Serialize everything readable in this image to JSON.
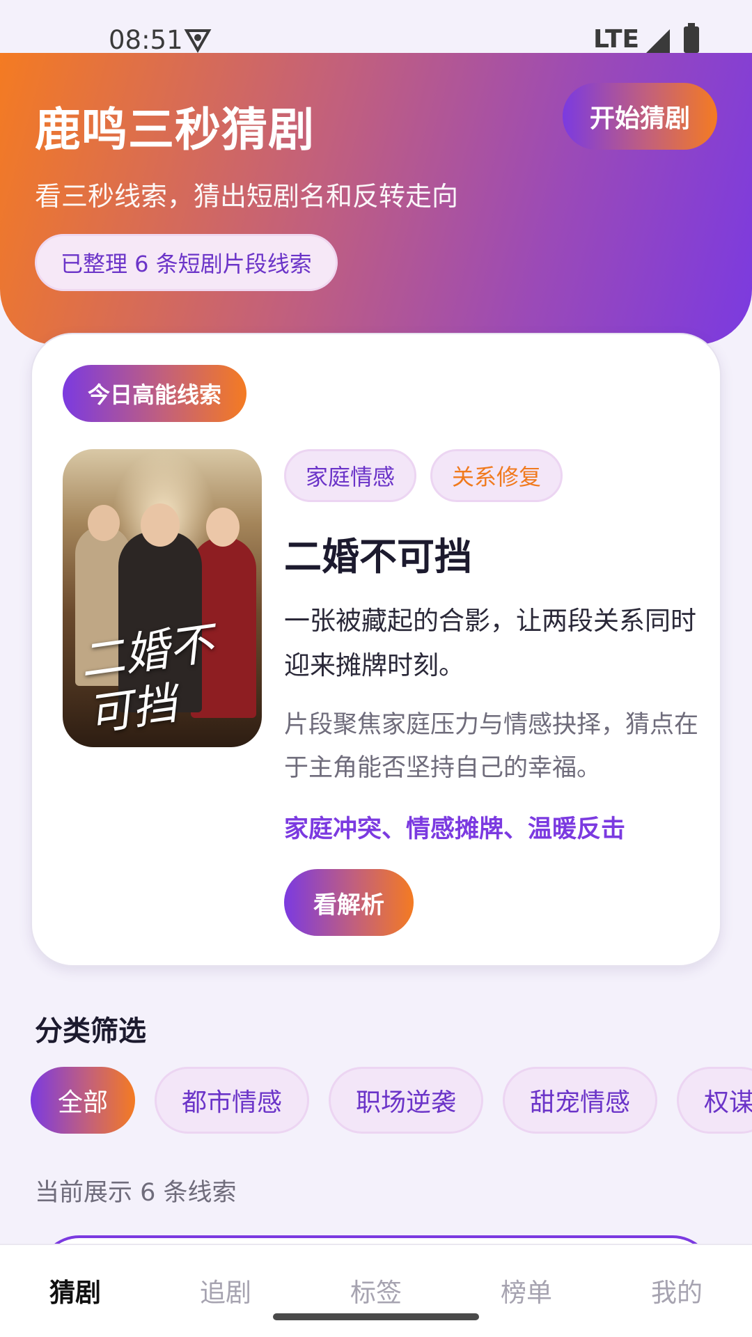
{
  "status_bar": {
    "time": "08:51",
    "network": "LTE"
  },
  "hero": {
    "title": "鹿鸣三秒猜剧",
    "subtitle": "看三秒线索，猜出短剧名和反转走向",
    "count_pill": "已整理 6 条短剧片段线索",
    "start_button": "开始猜剧"
  },
  "feature": {
    "badge": "今日高能线索",
    "poster_title": "二婚不可挡",
    "tags": [
      "家庭情感",
      "关系修复"
    ],
    "title": "二婚不可挡",
    "description": "一张被藏起的合影，让两段关系同时迎来摊牌时刻。",
    "detail": "片段聚焦家庭压力与情感抉择，猜点在于主角能否坚持自己的幸福。",
    "keywords": "家庭冲突、情感摊牌、温暖反击",
    "analysis_button": "看解析"
  },
  "categories": {
    "title": "分类筛选",
    "chips": [
      "全部",
      "都市情感",
      "职场逆袭",
      "甜宠情感",
      "权谋"
    ],
    "count_text": "当前展示 6 条线索"
  },
  "bottom_nav": {
    "items": [
      "猜剧",
      "追剧",
      "标签",
      "榜单",
      "我的"
    ]
  },
  "colors": {
    "accent_purple": "#7b3ae0",
    "accent_orange": "#f47b22",
    "tag_orange_text": "#f07a1e",
    "background": "#f4f1fb"
  }
}
